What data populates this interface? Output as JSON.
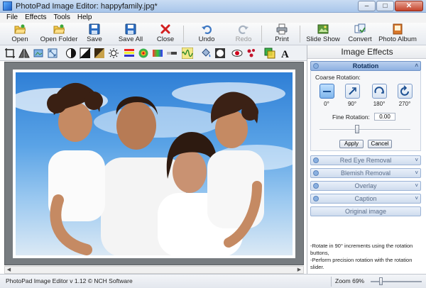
{
  "window": {
    "title": "PhotoPad Image Editor: happyfamily.jpg*"
  },
  "menu": [
    "File",
    "Effects",
    "Tools",
    "Help"
  ],
  "toolbar": [
    {
      "label": "Open",
      "icon": "open-folder-icon"
    },
    {
      "label": "Open Folder",
      "icon": "folder-icon"
    },
    {
      "label": "Save",
      "icon": "save-icon"
    },
    {
      "label": "Save All",
      "icon": "save-all-icon"
    },
    {
      "label": "Close",
      "icon": "close-x-icon"
    },
    {
      "label": "Undo",
      "icon": "undo-icon"
    },
    {
      "label": "Redo",
      "icon": "redo-icon",
      "disabled": true
    },
    {
      "label": "Print",
      "icon": "printer-icon"
    },
    {
      "label": "Slide Show",
      "icon": "slideshow-icon"
    },
    {
      "label": "Convert",
      "icon": "convert-icon"
    },
    {
      "label": "Photo Album",
      "icon": "photo-album-icon"
    }
  ],
  "side_panel": {
    "title": "Image Effects",
    "rotation": {
      "header": "Rotation",
      "coarse_label": "Coarse Rotation:",
      "angles": [
        "0°",
        "90°",
        "180°",
        "270°"
      ],
      "fine_label": "Fine Rotation:",
      "fine_value": "0.00",
      "apply_label": "Apply",
      "cancel_label": "Cancel"
    },
    "effects": [
      "Red Eye Removal",
      "Blemish Removal",
      "Overlay",
      "Caption",
      "Original image"
    ],
    "help_lines": [
      "-Rotate in 90° increments using the rotation buttons,",
      "-Perform precision rotation with the rotation slider."
    ]
  },
  "status": {
    "text": "PhotoPad Image Editor v 1.12 © NCH Software",
    "zoom": "Zoom 69%"
  },
  "colors": {
    "accent": "#3f79c4",
    "title_bar": "#b9d1f0",
    "close": "#c4442c"
  }
}
